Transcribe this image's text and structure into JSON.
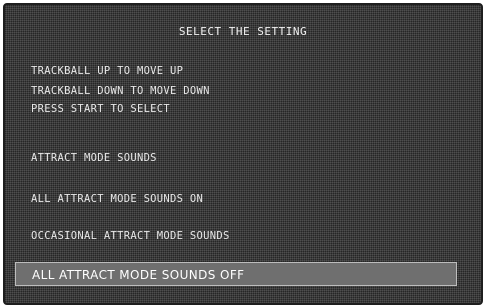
{
  "menu": {
    "title": "SELECT THE SETTING",
    "options": [
      "TRACKBALL UP TO MOVE UP",
      "TRACKBALL DOWN TO MOVE DOWN",
      "PRESS START TO SELECT",
      "ATTRACT MODE SOUNDS",
      "ALL ATTRACT MODE SOUNDS ON",
      "OCCASIONAL ATTRACT MODE SOUNDS",
      "ALL ATTRACT MODE SOUNDS OFF"
    ],
    "selected_index": 6
  },
  "colors": {
    "screen_bg": "#3a3a3a",
    "text": "#e8e8e8",
    "highlight_bg": "#6f6f6f",
    "highlight_border": "#bdbdbd"
  }
}
